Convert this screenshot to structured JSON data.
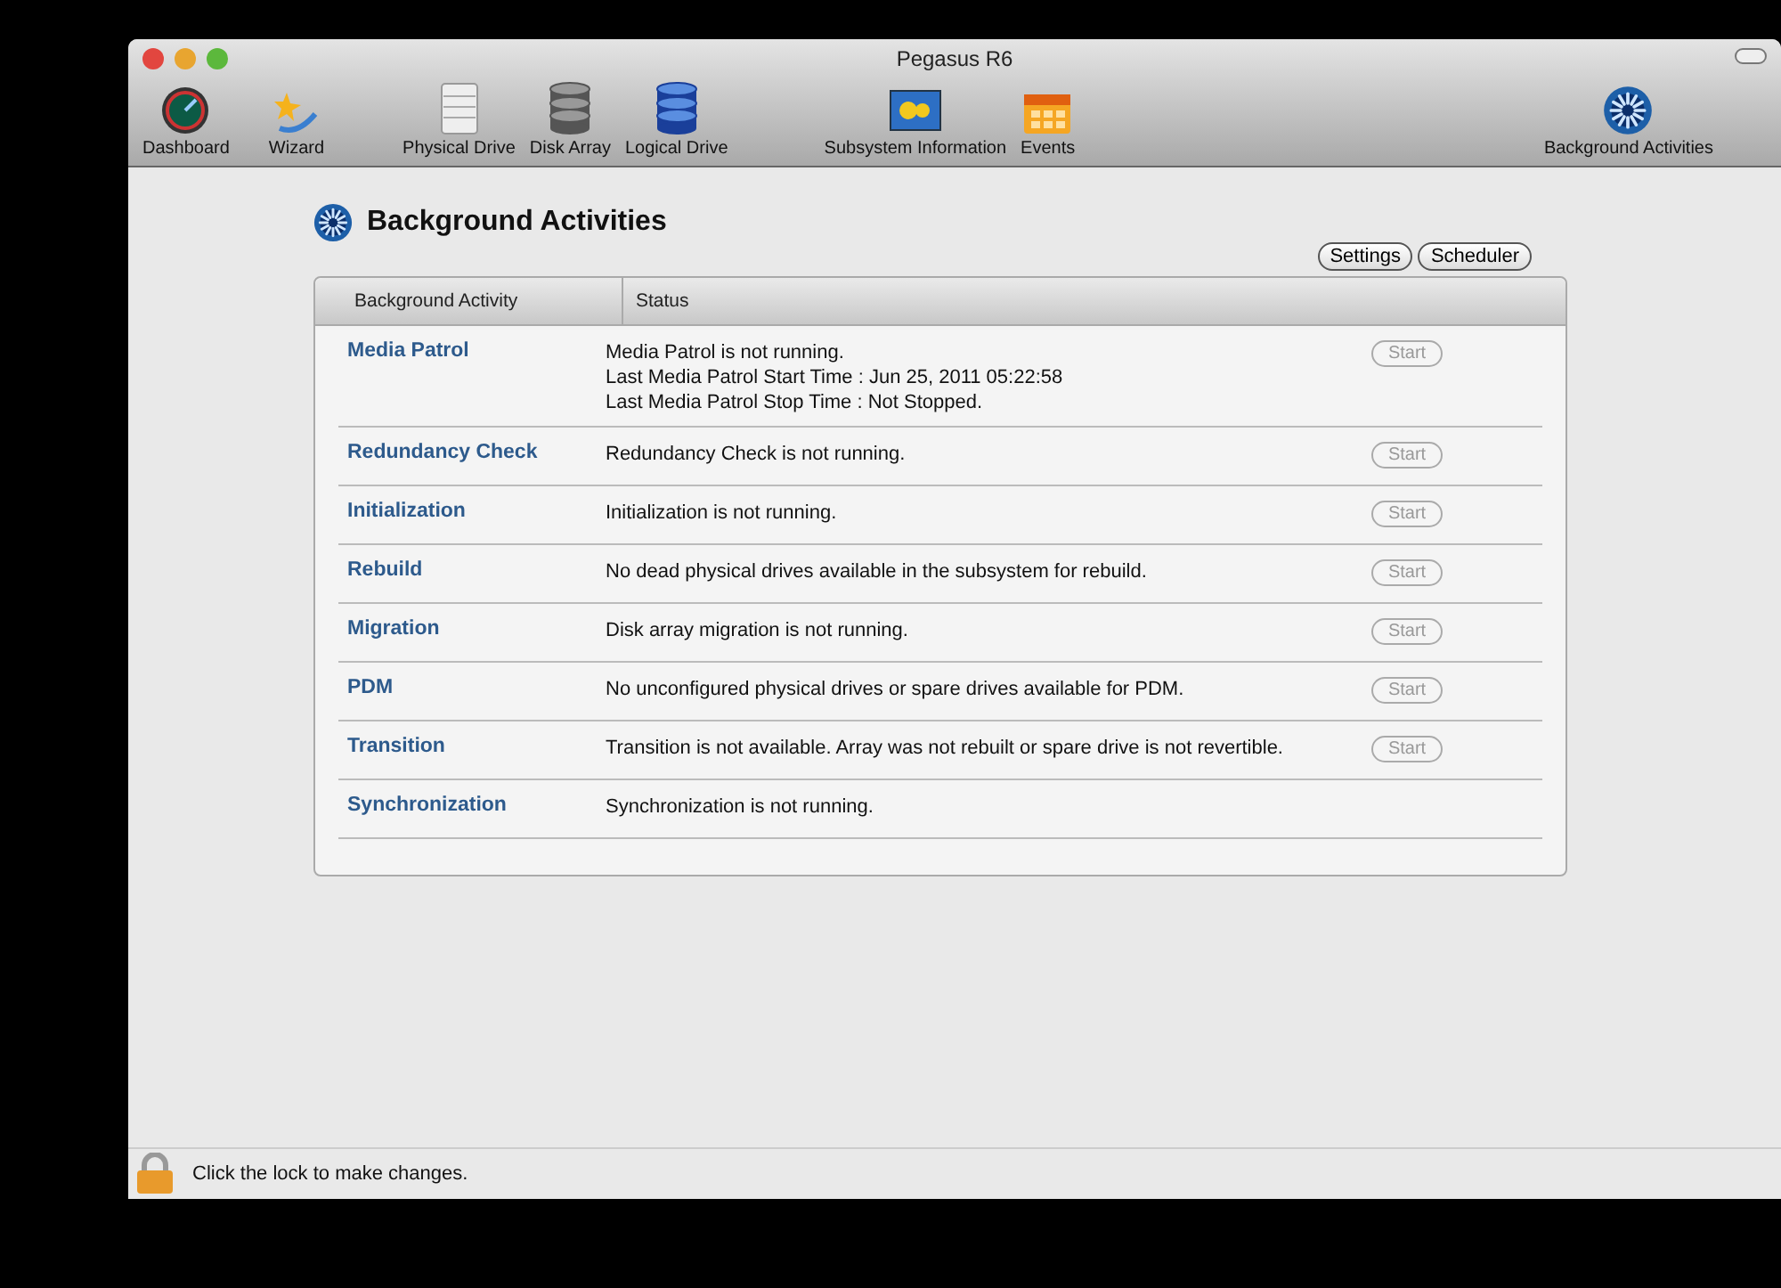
{
  "window": {
    "title": "Pegasus R6"
  },
  "toolbar": [
    {
      "label": "Dashboard",
      "kind": "dashboard"
    },
    {
      "label": "Wizard",
      "kind": "wizard"
    },
    {
      "label": "Physical Drive",
      "kind": "physical"
    },
    {
      "label": "Disk Array",
      "kind": "array"
    },
    {
      "label": "Logical Drive",
      "kind": "logical"
    },
    {
      "label": "Subsystem Information",
      "kind": "subsystem"
    },
    {
      "label": "Events",
      "kind": "events"
    },
    {
      "label": "Background Activities",
      "kind": "background"
    }
  ],
  "page": {
    "title": "Background Activities",
    "buttons": [
      "Settings",
      "Scheduler"
    ]
  },
  "table": {
    "columns": [
      "Background Activity",
      "Status"
    ],
    "rows": [
      {
        "activity": "Media Patrol",
        "status": [
          "Media Patrol is not running.",
          "Last Media Patrol Start Time : Jun 25, 2011 05:22:58",
          "Last Media Patrol Stop Time : Not Stopped."
        ],
        "start": {
          "label": "Start",
          "disabled": true
        }
      },
      {
        "activity": "Redundancy Check",
        "status": [
          "Redundancy Check is not running."
        ],
        "start": {
          "label": "Start",
          "disabled": true
        }
      },
      {
        "activity": "Initialization",
        "status": [
          "Initialization is not running."
        ],
        "start": {
          "label": "Start",
          "disabled": true
        }
      },
      {
        "activity": "Rebuild",
        "status": [
          "No dead physical drives available in the subsystem for rebuild."
        ],
        "start": {
          "label": "Start",
          "disabled": true
        }
      },
      {
        "activity": "Migration",
        "status": [
          "Disk array migration is not running."
        ],
        "start": {
          "label": "Start",
          "disabled": true
        }
      },
      {
        "activity": "PDM",
        "status": [
          "No unconfigured physical drives or spare drives available for PDM."
        ],
        "start": {
          "label": "Start",
          "disabled": true
        }
      },
      {
        "activity": "Transition",
        "status": [
          "Transition is not available. Array was not rebuilt or spare drive is not revertible."
        ],
        "start": {
          "label": "Start",
          "disabled": true
        }
      },
      {
        "activity": "Synchronization",
        "status": [
          "Synchronization is not running."
        ]
      }
    ]
  },
  "status_bar": {
    "text": "Click the lock to make changes."
  }
}
